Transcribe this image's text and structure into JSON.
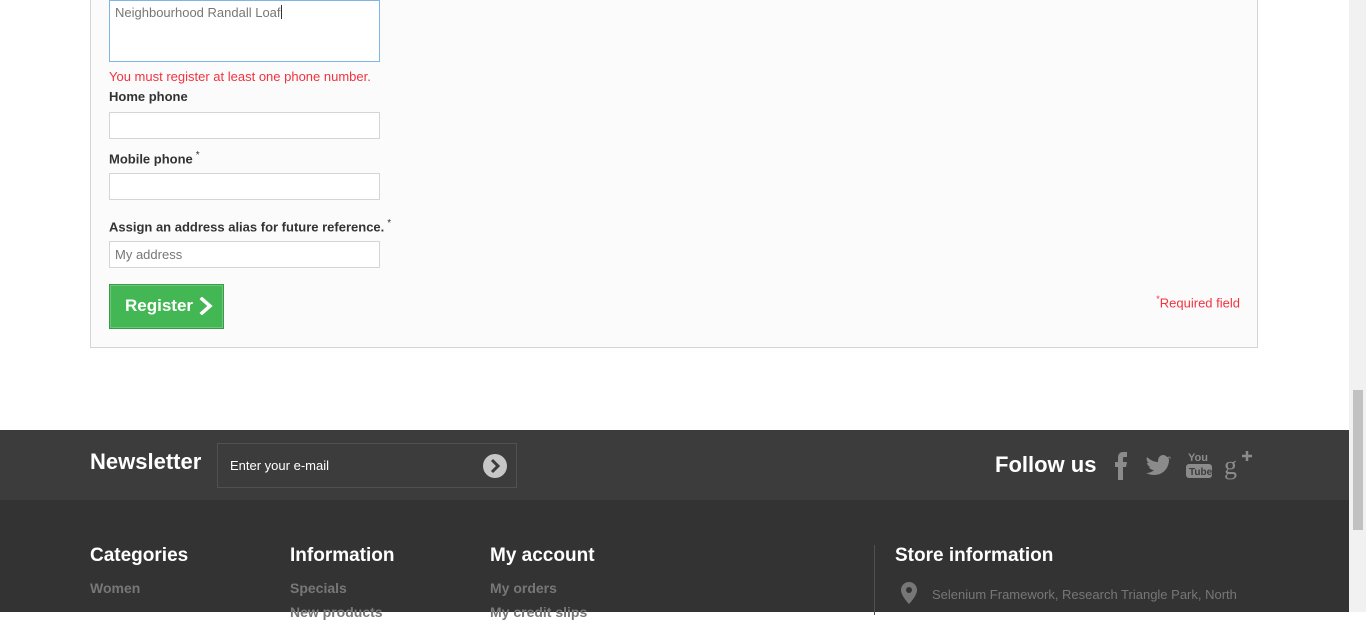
{
  "form": {
    "address_value": "Neighbourhood Randall Loaf",
    "phone_error": "You must register at least one phone number.",
    "home_phone_label": "Home phone",
    "home_phone_value": "",
    "mobile_phone_label": "Mobile phone",
    "mobile_phone_value": "",
    "required_mark": "*",
    "alias_label": "Assign an address alias for future reference.",
    "alias_placeholder": "My address",
    "register_label": "Register",
    "required_note": "Required field"
  },
  "newsletter": {
    "title": "Newsletter",
    "placeholder": "Enter your e-mail"
  },
  "follow": {
    "title": "Follow us",
    "networks": [
      "facebook-icon",
      "twitter-icon",
      "youtube-icon",
      "google-plus-icon"
    ]
  },
  "footer": {
    "categories": {
      "title": "Categories",
      "links": [
        "Women"
      ]
    },
    "information": {
      "title": "Information",
      "links": [
        "Specials",
        "New products"
      ]
    },
    "account": {
      "title": "My account",
      "links": [
        "My orders",
        "My credit slips"
      ]
    },
    "store": {
      "title": "Store information",
      "address": "Selenium Framework, Research Triangle Park, North"
    }
  },
  "colors": {
    "accent_green": "#43b754",
    "error_red": "#f13340",
    "footer_bg": "#333333",
    "newsletter_bg": "#3c3c3c"
  }
}
